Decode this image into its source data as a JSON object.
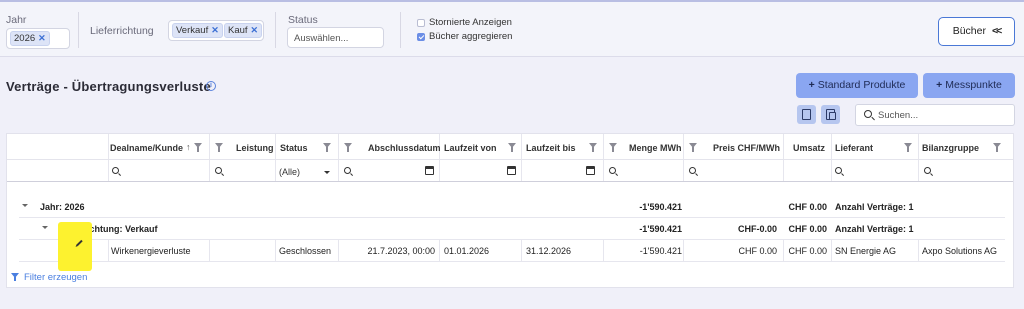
{
  "filters": {
    "jahr": {
      "label": "Jahr",
      "chips": [
        "2026"
      ]
    },
    "lieferrichtung": {
      "label": "Lieferrichtung",
      "chips": [
        "Verkauf",
        "Kauf"
      ]
    },
    "status": {
      "label": "Status",
      "placeholder": "Auswählen..."
    },
    "checkboxes": [
      {
        "label": "Stornierte Anzeigen",
        "checked": false
      },
      {
        "label": "Bücher aggregieren",
        "checked": true
      }
    ],
    "buecher_button": "Bücher",
    "buecher_chevron": "<<"
  },
  "page": {
    "title": "Verträge - Übertragungsverluste",
    "info_icon": "i"
  },
  "actions": {
    "standard_produkte": "Standard Produkte",
    "messpunkte": "Messpunkte",
    "plus": "+",
    "search_placeholder": "Suchen..."
  },
  "grid": {
    "columns": [
      "Dealname/Kunde",
      "Leistung",
      "Status",
      "Abschlussdatum",
      "Laufzeit von",
      "Laufzeit bis",
      "Menge MWh",
      "Preis CHF/MWh",
      "Umsatz",
      "Lieferant",
      "Bilanzgruppe"
    ],
    "status_filter": "(Alle)",
    "group_year": {
      "label": "Jahr: 2026",
      "menge": "-1'590.421",
      "umsatz": "CHF 0.00",
      "count": "Anzahl Verträge: 1"
    },
    "group_direction": {
      "label": "Lieferrichtung: Verkauf",
      "menge": "-1'590.421",
      "preis": "CHF-0.00",
      "umsatz": "CHF 0.00",
      "count": "Anzahl Verträge: 1"
    },
    "rows": [
      {
        "dealname": "Wirkenergieverluste",
        "leistung": "",
        "status": "Geschlossen",
        "abschlussdatum": "21.7.2023, 00:00",
        "laufzeit_von": "01.01.2026",
        "laufzeit_bis": "31.12.2026",
        "menge": "-1'590.421",
        "preis": "CHF 0.00",
        "umsatz": "CHF 0.00",
        "lieferant": "SN Energie AG",
        "bilanzgruppe": "Axpo Solutions AG"
      }
    ]
  },
  "footer": {
    "filter_link": "Filter erzeugen"
  }
}
